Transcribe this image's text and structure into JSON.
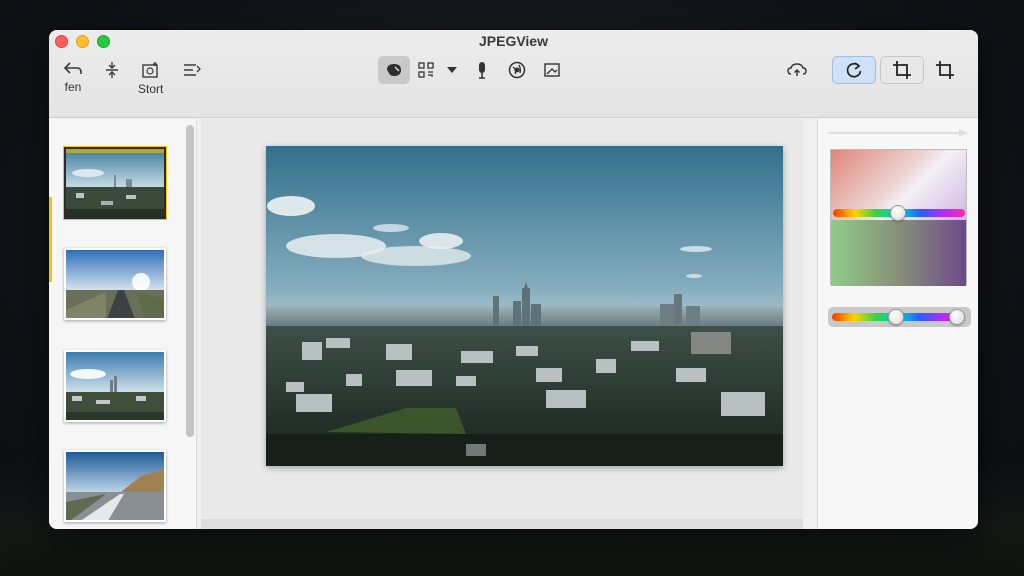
{
  "window": {
    "title": "JPEGView"
  },
  "toolbar": {
    "back": {
      "icon": "undo-arrow-icon",
      "label": "fen"
    },
    "adjust": {
      "icon": "adjust-arrows-icon"
    },
    "sort": {
      "icon": "sort-image-icon",
      "label": "Stort"
    },
    "list": {
      "icon": "list-icon"
    },
    "center_tools": [
      "mask-icon",
      "qr-icon",
      "dropdown-icon",
      "microphone-icon",
      "globe-icon",
      "frame-image-icon"
    ],
    "right_tools": [
      "cloud-upload-icon",
      "rotate-icon",
      "crop-icon",
      "crop-icon"
    ]
  },
  "thumbnails": [
    {
      "name": "city-skyline",
      "selected": true
    },
    {
      "name": "road-sky",
      "selected": false
    },
    {
      "name": "city-clouds",
      "selected": false
    },
    {
      "name": "highway-hills",
      "selected": false
    },
    {
      "name": "partial",
      "selected": false
    }
  ],
  "colors": {
    "selection": "#f2c400",
    "active_tool": "#cfe1f7"
  }
}
